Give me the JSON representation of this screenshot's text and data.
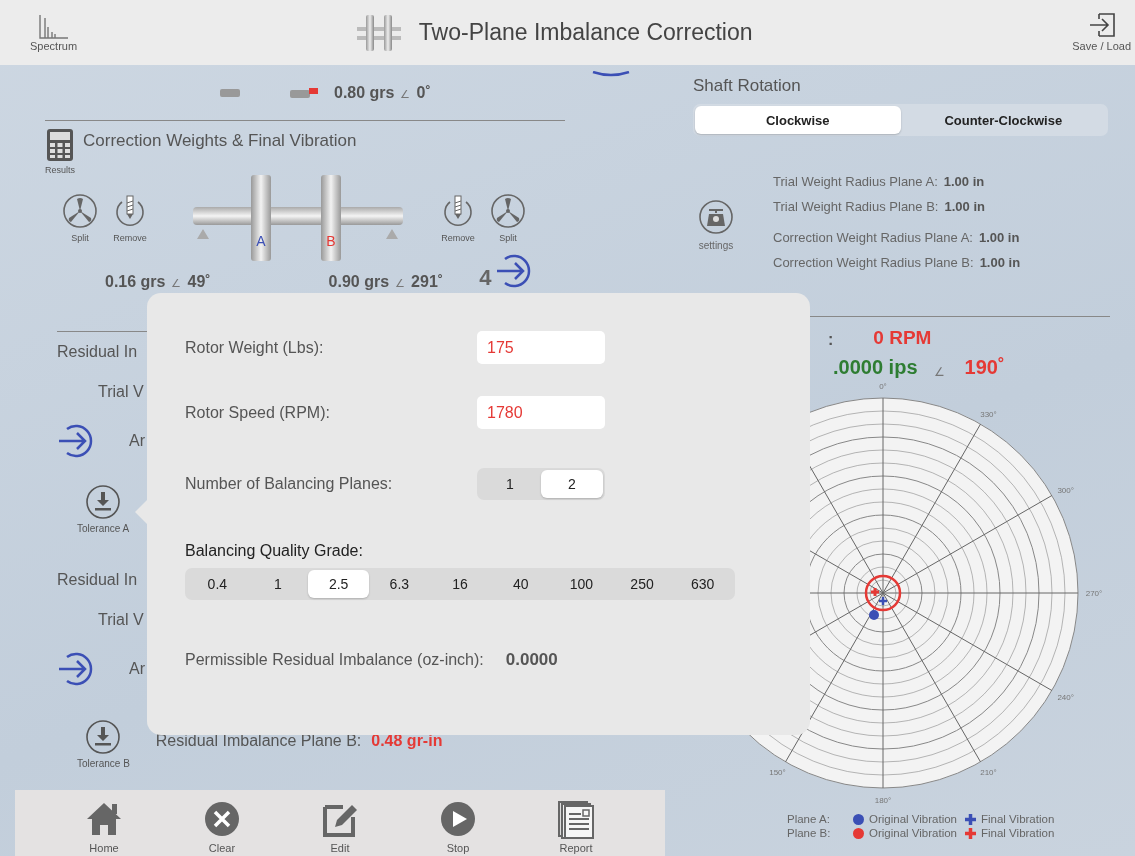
{
  "header": {
    "left_button": {
      "label": "Spectrum"
    },
    "title": "Two-Plane Imbalance Correction",
    "right_button": {
      "label": "Save / Load"
    }
  },
  "trial_row": {
    "value": "0.80 grs",
    "angle_symbol": "∠",
    "angle": "0˚"
  },
  "correction": {
    "title": "Correction Weights & Final Vibration",
    "results_label": "Results",
    "left_tools": [
      {
        "kind": "split",
        "label": "Split"
      },
      {
        "kind": "remove",
        "label": "Remove"
      }
    ],
    "plane_labels": [
      {
        "label": "A",
        "color": "#3b4fb5"
      },
      {
        "label": "B",
        "color": "#e53935"
      }
    ],
    "right_tools": [
      {
        "kind": "remove",
        "label": "Remove"
      },
      {
        "kind": "split",
        "label": "Split"
      }
    ],
    "weights": [
      {
        "value": "0.16 grs",
        "angle_symbol": "∠",
        "angle": "49˚"
      },
      {
        "value": "0.90 grs",
        "angle_symbol": "∠",
        "angle": "291˚"
      }
    ],
    "step": "4"
  },
  "residual_sections": [
    {
      "heading": "Residual In",
      "trial": "Trial V",
      "arrow_text": "Ar",
      "tolerance_label": "Tolerance A"
    },
    {
      "heading": "Residual In",
      "trial": "Trial V",
      "arrow_text": "Ar",
      "tolerance_label": "Tolerance B",
      "result_label": "Residual Imbalance Plane B:",
      "result_value": "0.48 gr-in"
    }
  ],
  "toolbar": [
    {
      "kind": "home",
      "label": "Home"
    },
    {
      "kind": "clear",
      "label": "Clear"
    },
    {
      "kind": "edit",
      "label": "Edit"
    },
    {
      "kind": "stop",
      "label": "Stop"
    },
    {
      "kind": "report",
      "label": "Report"
    }
  ],
  "shaft_rotation": {
    "title": "Shaft Rotation",
    "options": [
      {
        "label": "Clockwise",
        "selected": true
      },
      {
        "label": "Counter-Clockwise",
        "selected": false
      }
    ]
  },
  "radii": {
    "settings_label": "settings",
    "lines": [
      {
        "label": "Trial Weight Radius Plane A:",
        "value": "1.00 in"
      },
      {
        "label": "Trial Weight Radius Plane B:",
        "value": "1.00 in"
      },
      {
        "label": "Correction Weight Radius Plane A:",
        "value": "1.00 in"
      },
      {
        "label": "Correction Weight Radius Plane B:",
        "value": "1.00 in"
      }
    ]
  },
  "live": {
    "prefix": ":",
    "speed": "0 RPM",
    "amplitude": ".0000 ips",
    "angle_symbol": "∠",
    "phase": "190˚"
  },
  "polar": {
    "angle_labels": [
      "0°",
      "330°",
      "300°",
      "270°",
      "240°",
      "210°",
      "180°",
      "150°"
    ]
  },
  "legend": [
    {
      "plane": "Plane A:",
      "color": "#3b4fb5",
      "original": "Original Vibration",
      "final": "Final Vibration"
    },
    {
      "plane": "Plane B:",
      "color": "#e53935",
      "original": "Original Vibration",
      "final": "Final Vibration"
    }
  ],
  "popover": {
    "fields": [
      {
        "label": "Rotor Weight (Lbs):",
        "value": "175"
      },
      {
        "label": "Rotor Speed (RPM):",
        "value": "1780"
      }
    ],
    "planes": {
      "label": "Number of Balancing Planes:",
      "options": [
        {
          "label": "1",
          "selected": false
        },
        {
          "label": "2",
          "selected": true
        }
      ]
    },
    "grade": {
      "label": "Balancing Quality Grade:",
      "options": [
        {
          "label": "0.4",
          "selected": false
        },
        {
          "label": "1",
          "selected": false
        },
        {
          "label": "2.5",
          "selected": true
        },
        {
          "label": "6.3",
          "selected": false
        },
        {
          "label": "16",
          "selected": false
        },
        {
          "label": "40",
          "selected": false
        },
        {
          "label": "100",
          "selected": false
        },
        {
          "label": "250",
          "selected": false
        },
        {
          "label": "630",
          "selected": false
        }
      ]
    },
    "permissible": {
      "label": "Permissible Residual Imbalance (oz-inch):",
      "value": "0.0000"
    }
  }
}
